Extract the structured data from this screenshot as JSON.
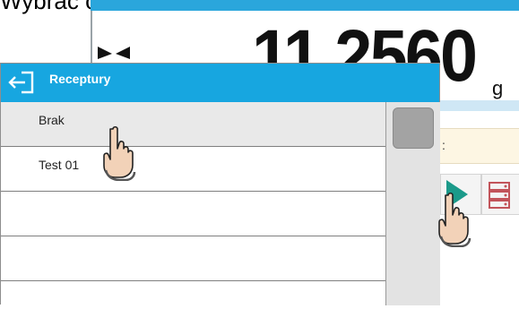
{
  "caption": "Wybrać opcję < Brak >.",
  "scale": {
    "weight": "11.2560",
    "unit": "g",
    "info_text": ":"
  },
  "dialog": {
    "title": "Receptury",
    "items": [
      "Brak",
      "Test 01",
      "",
      "",
      ""
    ],
    "selected_index": 0
  },
  "colors": {
    "header": "#17a6e0",
    "play": "#1b9a8a",
    "database": "#c2545a"
  },
  "icons": [
    "back-arrow-icon",
    "stability-icon",
    "play-icon",
    "database-icon",
    "hand-pointer-icon"
  ]
}
